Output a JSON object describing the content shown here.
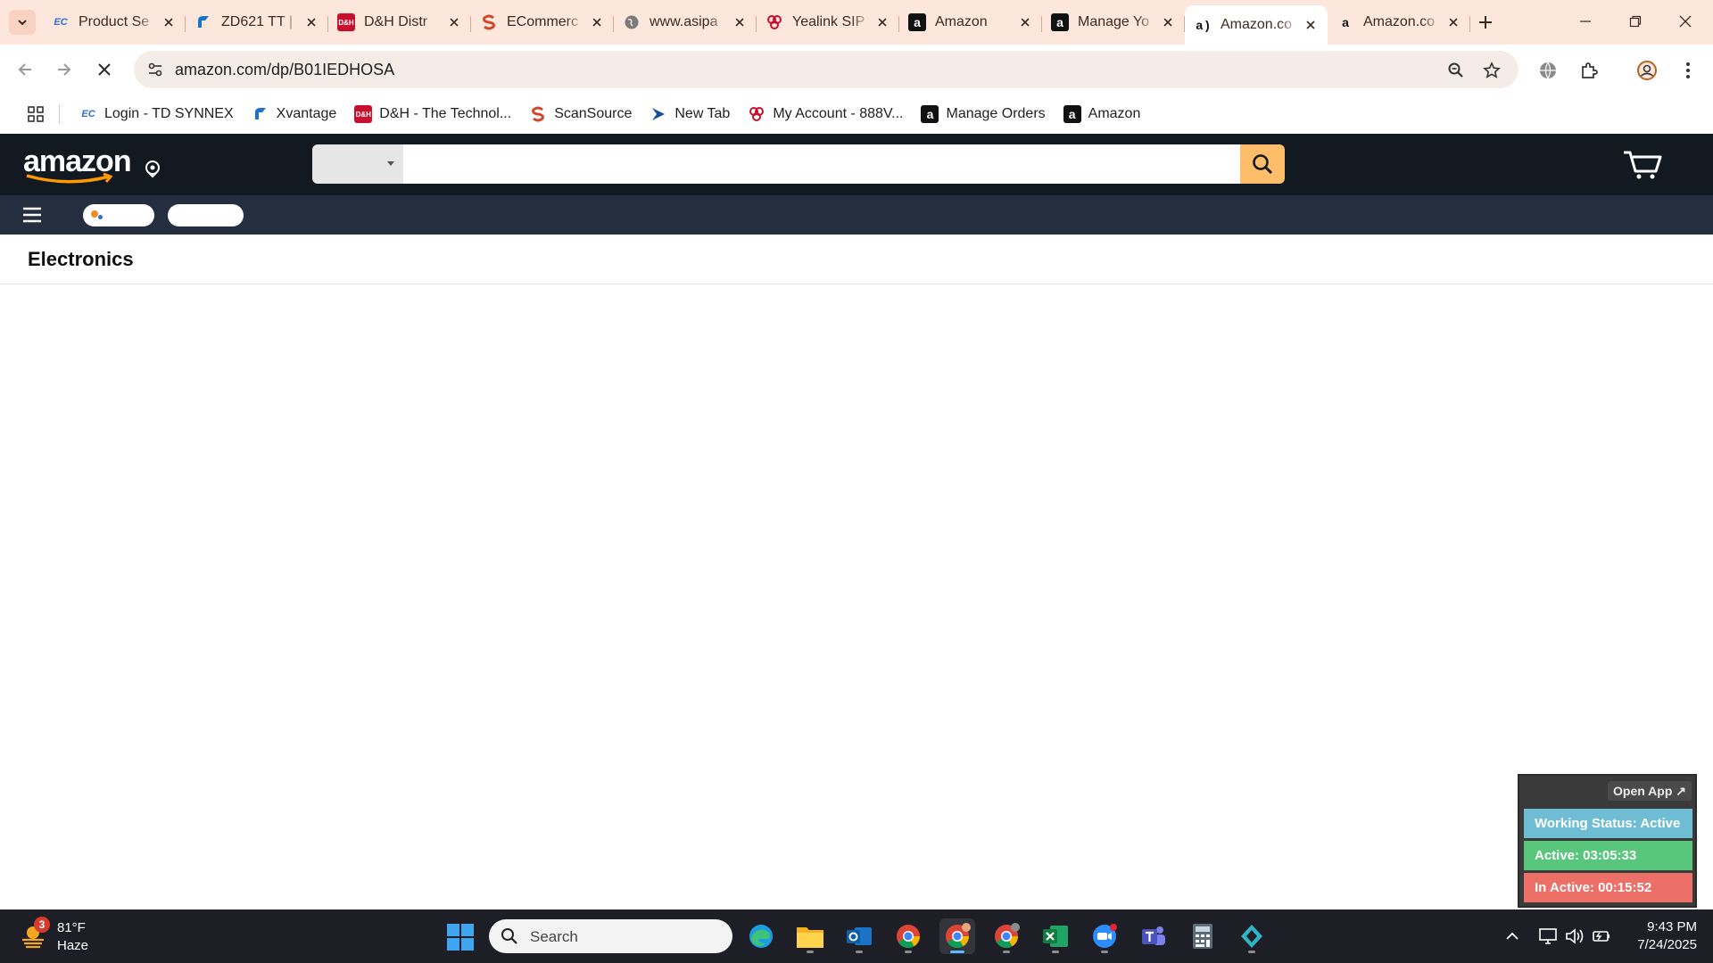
{
  "browser": {
    "tabs": [
      {
        "title": "Product Se",
        "favicon": "ec-icon",
        "color": "#2e6fd0"
      },
      {
        "title": "ZD621 TT |",
        "favicon": "xvantage-icon",
        "color": "#1a73c8"
      },
      {
        "title": "D&H Distr",
        "favicon": "dh-icon",
        "color": "#c8102e"
      },
      {
        "title": "ECommerc",
        "favicon": "scansource-icon",
        "color": "#d2462b"
      },
      {
        "title": "www.asipa",
        "favicon": "globe-icon",
        "color": "#6b6b6b"
      },
      {
        "title": "Yealink SIP",
        "favicon": "888voip-icon",
        "color": "#c8102e"
      },
      {
        "title": "Amazon",
        "favicon": "amazon-icon",
        "color": "#111111"
      },
      {
        "title": "Manage Yo",
        "favicon": "amazon-icon",
        "color": "#111111"
      },
      {
        "title": "Amazon.co",
        "favicon": "amazon-smile-icon",
        "color": "#111111",
        "active": true
      },
      {
        "title": "Amazon.co",
        "favicon": "amazon-smile-icon",
        "color": "#111111"
      }
    ],
    "url": "amazon.com/dp/B01IEDHOSA"
  },
  "bookmarks": [
    {
      "label": "Login - TD SYNNEX",
      "favicon": "ec-icon",
      "color": "#2e6fd0"
    },
    {
      "label": "Xvantage",
      "favicon": "xvantage-icon",
      "color": "#1a73c8"
    },
    {
      "label": "D&H - The Technol...",
      "favicon": "dh-icon",
      "color": "#c8102e"
    },
    {
      "label": "ScanSource",
      "favicon": "scansource-icon",
      "color": "#d2462b"
    },
    {
      "label": "New Tab",
      "favicon": "arrow-icon",
      "color": "#1a4fa0"
    },
    {
      "label": "My Account - 888V...",
      "favicon": "888voip-icon",
      "color": "#c8102e"
    },
    {
      "label": "Manage Orders",
      "favicon": "amazon-icon",
      "color": "#111111"
    },
    {
      "label": "Amazon",
      "favicon": "amazon-icon",
      "color": "#111111"
    }
  ],
  "amazon": {
    "logo_text": "amazon",
    "search_value": "",
    "category_title": "Electronics",
    "colors": {
      "nav": "#131921",
      "subnav": "#232f3e",
      "search_button": "#febd69"
    }
  },
  "tracker": {
    "open_app": "Open App ↗",
    "status": "Working Status: Active",
    "active": "Active: 03:05:33",
    "inactive": "In Active: 00:15:52",
    "colors": {
      "status": "#6fbdd3",
      "active": "#58c77b",
      "inactive": "#ec6f68"
    }
  },
  "taskbar": {
    "weather_badge": "3",
    "weather_temp": "81°F",
    "weather_desc": "Haze",
    "search_placeholder": "Search",
    "time": "9:43 PM",
    "date": "7/24/2025"
  }
}
